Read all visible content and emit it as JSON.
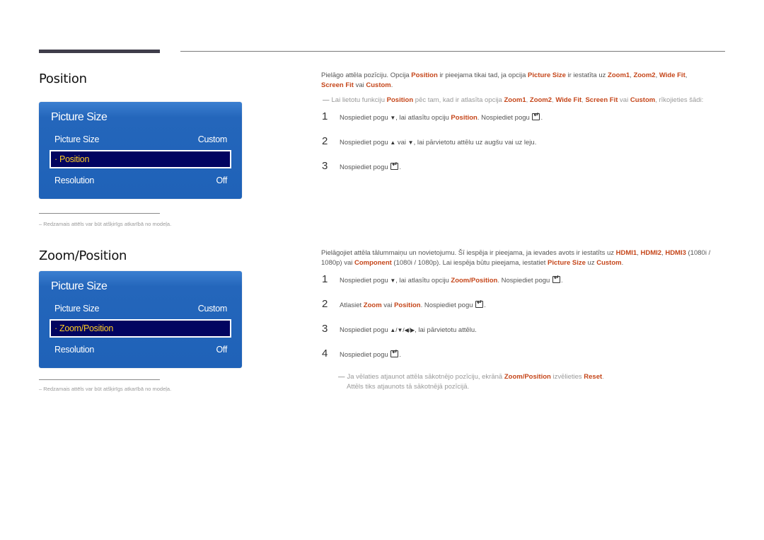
{
  "sections": [
    {
      "title": "Position",
      "osd": {
        "title": "Picture Size",
        "rows": [
          {
            "label": "Picture Size",
            "value": "Custom"
          },
          {
            "label": "· Position",
            "value": "",
            "selected": true
          },
          {
            "label": "Resolution",
            "value": "Off"
          }
        ]
      },
      "footnote": "Redzamais attēls var būt atšķirīgs atkarībā no modeļa.",
      "intro": {
        "t1": "Pielāgo attēla pozīciju. Opcija ",
        "h1": "Position",
        "t2": " ir pieejama tikai tad, ja opcija ",
        "h2": "Picture Size",
        "t3": " ir iestatīta uz ",
        "h3": "Zoom1",
        "t4": ", ",
        "h4": "Zoom2",
        "t5": ", ",
        "h5": "Wide Fit",
        "t6": ", ",
        "h6": "Screen Fit",
        "t7": " vai ",
        "h7": "Custom",
        "t8": "."
      },
      "note": {
        "t1": "Lai lietotu funkciju ",
        "h1": "Position",
        "t2": " pēc tam, kad ir atlasīta opcija ",
        "h2": "Zoom1",
        "t3": ", ",
        "h3": "Zoom2",
        "t4": ", ",
        "h4": "Wide Fit",
        "t5": ", ",
        "h5": "Screen Fit",
        "t6": " vai ",
        "h6": "Custom",
        "t7": ", rīkojieties šādi:"
      },
      "steps": [
        {
          "num": "1",
          "t1": "Nospiediet pogu ",
          "g1": "▼",
          "t2": ", lai atlasītu opciju ",
          "h1": "Position",
          "t3": ". Nospiediet pogu "
        },
        {
          "num": "2",
          "t1": "Nospiediet pogu ",
          "g1": "▲",
          "t2": " vai ",
          "g2": "▼",
          "t3": ", lai pārvietotu attēlu uz augšu vai uz leju."
        },
        {
          "num": "3",
          "t1": "Nospiediet pogu "
        }
      ]
    },
    {
      "title": "Zoom/Position",
      "osd": {
        "title": "Picture Size",
        "rows": [
          {
            "label": "Picture Size",
            "value": "Custom"
          },
          {
            "label": "· Zoom/Position",
            "value": "",
            "selected": true
          },
          {
            "label": "Resolution",
            "value": "Off"
          }
        ]
      },
      "footnote": "Redzamais attēls var būt atšķirīgs atkarībā no modeļa.",
      "intro": {
        "t1": "Pielāgojiet attēla tālummaiņu un novietojumu. Šī iespēja ir pieejama, ja ievades avots ir iestatīts uz ",
        "h1": "HDMI1",
        "t2": ", ",
        "h2": "HDMI2",
        "t3": ", ",
        "h3": "HDMI3",
        "t4": " (1080i / 1080p) vai ",
        "h4": "Component",
        "t5": " (1080i / 1080p). Lai iespēja būtu pieejama, iestatiet ",
        "h5": "Picture Size",
        "t6": " uz ",
        "h6": "Custom",
        "t7": "."
      },
      "steps": [
        {
          "num": "1",
          "t1": "Nospiediet pogu ",
          "g1": "▼",
          "t2": ", lai atlasītu opciju ",
          "h1": "Zoom/Position",
          "t3": ". Nospiediet pogu "
        },
        {
          "num": "2",
          "t1": "Atlasiet ",
          "h1": "Zoom",
          "t2": " vai ",
          "h2": "Position",
          "t3": ". Nospiediet pogu "
        },
        {
          "num": "3",
          "t1": "Nospiediet pogu ",
          "g1": "▲/▼/◀/▶",
          "t2": ", lai pārvietotu attēlu."
        },
        {
          "num": "4",
          "t1": "Nospiediet pogu "
        }
      ],
      "note": {
        "t1": "Ja vēlaties atjaunot attēla sākotnējo pozīciju, ekrānā ",
        "h1": "Zoom/Position",
        "t2": " izvēlieties ",
        "h2": "Reset",
        "t3": ".",
        "line2": "Attēls tiks atjaunots tā sākotnējā pozīcijā."
      }
    }
  ],
  "colors": {
    "accent": "#c5461a",
    "osd_bg": "#1f62b8",
    "osd_selected_bg": "#020460",
    "osd_selected_text": "#ffcc22"
  }
}
